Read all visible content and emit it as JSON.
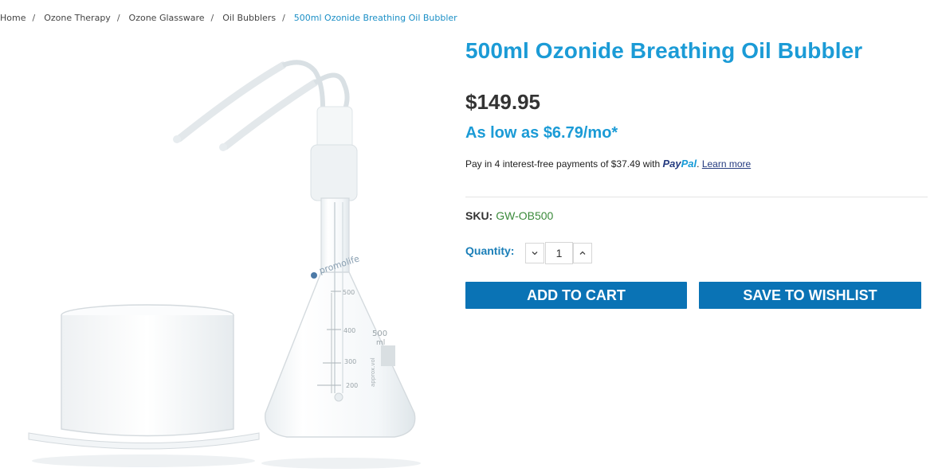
{
  "breadcrumbs": {
    "items": [
      "Home",
      "Ozone Therapy",
      "Ozone Glassware",
      "Oil Bubblers"
    ],
    "separator": "/",
    "current": "500ml Ozonide Breathing Oil Bubbler"
  },
  "image": {
    "brand_mark": "promolife",
    "capacity_label": "500",
    "capacity_unit": "ml",
    "approx_label": "approx.vol",
    "graduations": [
      "500",
      "400",
      "300",
      "200"
    ]
  },
  "product": {
    "title": "500ml Ozonide Breathing Oil Bubbler",
    "price": "$149.95",
    "monthly": "As low as $6.79/mo*",
    "paypal_prefix": "Pay in 4 interest-free payments of $37.49 with",
    "paypal_pay": "Pay",
    "paypal_pal": "Pal",
    "paypal_learn_more": "Learn more",
    "sku_label": "SKU:",
    "sku_value": "GW-OB500",
    "quantity_label": "Quantity:",
    "quantity_value": "1"
  },
  "buttons": {
    "add_to_cart": "ADD TO CART",
    "save_to_wishlist": "SAVE TO WISHLIST"
  },
  "colors": {
    "accent": "#1b9bd6",
    "button": "#0a73b5",
    "sku": "#3a8a3a"
  },
  "icons": {
    "decrement": "chevron-down-icon",
    "increment": "chevron-up-icon"
  }
}
